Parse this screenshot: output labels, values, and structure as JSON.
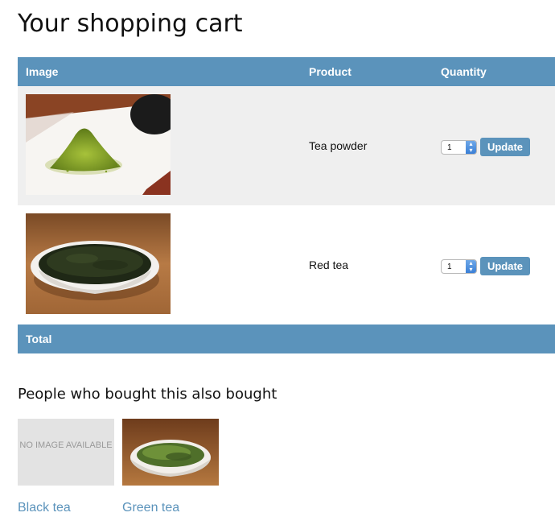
{
  "page_title": "Your shopping cart",
  "table": {
    "headers": {
      "image": "Image",
      "product": "Product",
      "quantity": "Quantity"
    },
    "rows": [
      {
        "product": "Tea powder",
        "quantity": "1",
        "button": "Update",
        "image_icon": "matcha-powder-photo"
      },
      {
        "product": "Red tea",
        "quantity": "1",
        "button": "Update",
        "image_icon": "tea-leaves-bowl-photo"
      }
    ],
    "footer_label": "Total"
  },
  "also_bought": {
    "title": "People who bought this also bought",
    "items": [
      {
        "name": "Black tea",
        "placeholder": "NO IMAGE AVAILABLE"
      },
      {
        "name": "Green tea",
        "image_icon": "green-tea-bowl-photo"
      }
    ]
  },
  "colors": {
    "accent": "#5b93bb",
    "row_alt": "#efefef"
  }
}
